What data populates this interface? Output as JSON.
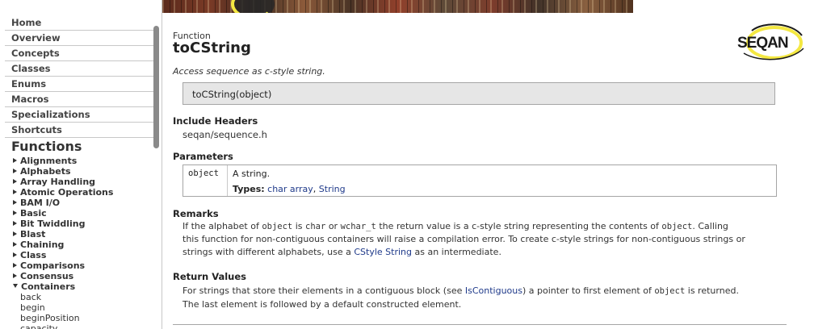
{
  "sidebar": {
    "nav_items": [
      "Home",
      "Overview",
      "Concepts",
      "Classes",
      "Enums",
      "Macros",
      "Specializations",
      "Shortcuts"
    ],
    "functions_heading": "Functions",
    "function_groups": [
      {
        "label": "Alignments",
        "expanded": false
      },
      {
        "label": "Alphabets",
        "expanded": false
      },
      {
        "label": "Array Handling",
        "expanded": false
      },
      {
        "label": "Atomic Operations",
        "expanded": false
      },
      {
        "label": "BAM I/O",
        "expanded": false
      },
      {
        "label": "Basic",
        "expanded": false
      },
      {
        "label": "Bit Twiddling",
        "expanded": false
      },
      {
        "label": "Blast",
        "expanded": false
      },
      {
        "label": "Chaining",
        "expanded": false
      },
      {
        "label": "Class",
        "expanded": false
      },
      {
        "label": "Comparisons",
        "expanded": false
      },
      {
        "label": "Consensus",
        "expanded": false
      },
      {
        "label": "Containers",
        "expanded": true
      }
    ],
    "container_subitems": [
      "back",
      "begin",
      "beginPosition",
      "capacity"
    ]
  },
  "page": {
    "kind": "Function",
    "title": "toCString",
    "brief": "Access sequence as c-style string.",
    "signature": "toCString(object)",
    "include_heading": "Include Headers",
    "include_file": "seqan/sequence.h",
    "params_heading": "Parameters",
    "param": {
      "name": "object",
      "description": "A string.",
      "types_label": "Types:",
      "types": [
        "char array",
        "String"
      ],
      "types_sep": ", "
    },
    "remarks_heading": "Remarks",
    "remarks": {
      "l1_a": "If the alphabet of ",
      "l1_code1": "object",
      "l1_b": " is ",
      "l1_code2": "char",
      "l1_c": " or ",
      "l1_code3": "wchar_t",
      "l1_d": " the return value is a c-style string representing the contents of ",
      "l1_code4": "object",
      "l1_e": ". Calling",
      "l2": "this function for non-contiguous containers will raise a compilation error. To create c-style strings for non-contiguous strings or",
      "l3_a": "strings with different alphabets, use a ",
      "l3_link": "CStyle String",
      "l3_b": " as an intermediate."
    },
    "return_heading": "Return Values",
    "return_values": {
      "l1_a": "For strings that store their elements in a contiguous block (see ",
      "l1_link": "IsContiguous",
      "l1_b": ") a pointer to first element of ",
      "l1_code": "object",
      "l1_c": " is returned.",
      "l2": "The last element is followed by a default constructed element."
    },
    "logo_text": "SEQAN"
  },
  "colors": {
    "link": "#1f3a8a",
    "signature_bg": "#e6e6e6",
    "border": "#a5a5a5",
    "logo_yellow": "#f4e842"
  }
}
